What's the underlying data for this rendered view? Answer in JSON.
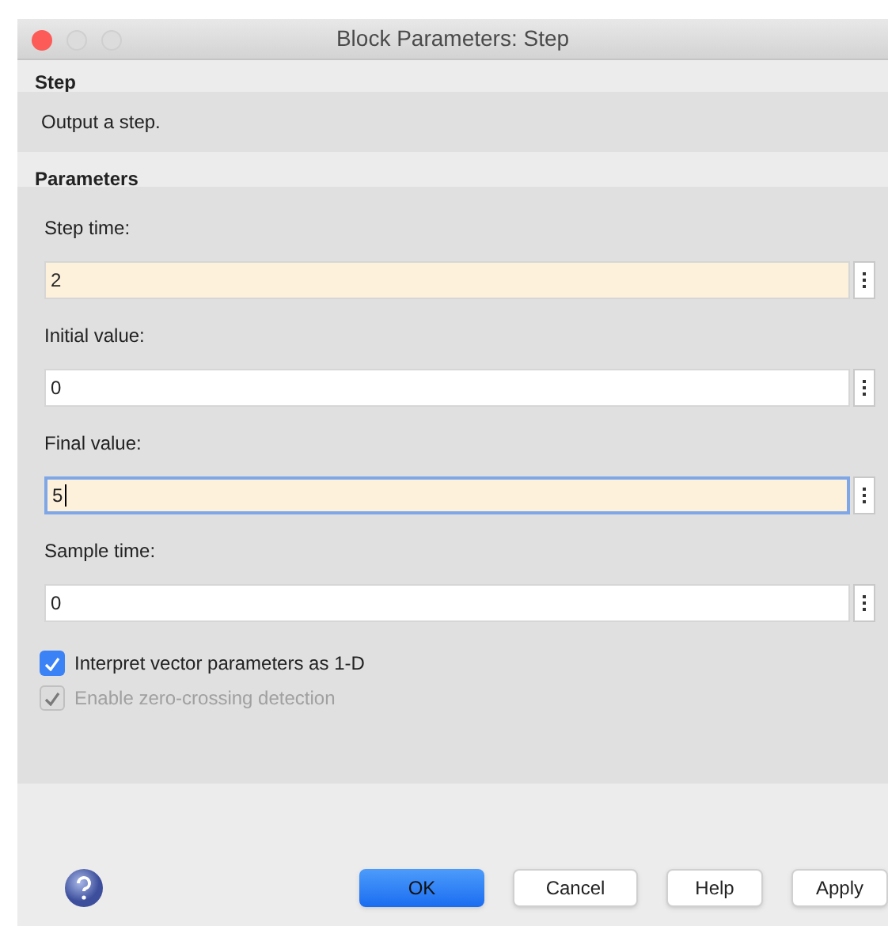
{
  "window": {
    "title": "Block Parameters: Step"
  },
  "block": {
    "heading": "Step",
    "description": "Output a step."
  },
  "parameters": {
    "heading": "Parameters",
    "fields": [
      {
        "label": "Step time:",
        "value": "2",
        "modified": true,
        "focused": false
      },
      {
        "label": "Initial value:",
        "value": "0",
        "modified": false,
        "focused": false
      },
      {
        "label": "Final value:",
        "value": "5",
        "modified": true,
        "focused": true
      },
      {
        "label": "Sample time:",
        "value": "0",
        "modified": false,
        "focused": false
      }
    ],
    "checkboxes": [
      {
        "label": "Interpret vector parameters as 1-D",
        "checked": true,
        "disabled": false
      },
      {
        "label": "Enable zero-crossing detection",
        "checked": true,
        "disabled": true
      }
    ]
  },
  "buttons": [
    {
      "label": "OK",
      "kind": "primary"
    },
    {
      "label": "Cancel",
      "kind": "normal"
    },
    {
      "label": "Help",
      "kind": "normal"
    },
    {
      "label": "Apply",
      "kind": "normal"
    }
  ]
}
